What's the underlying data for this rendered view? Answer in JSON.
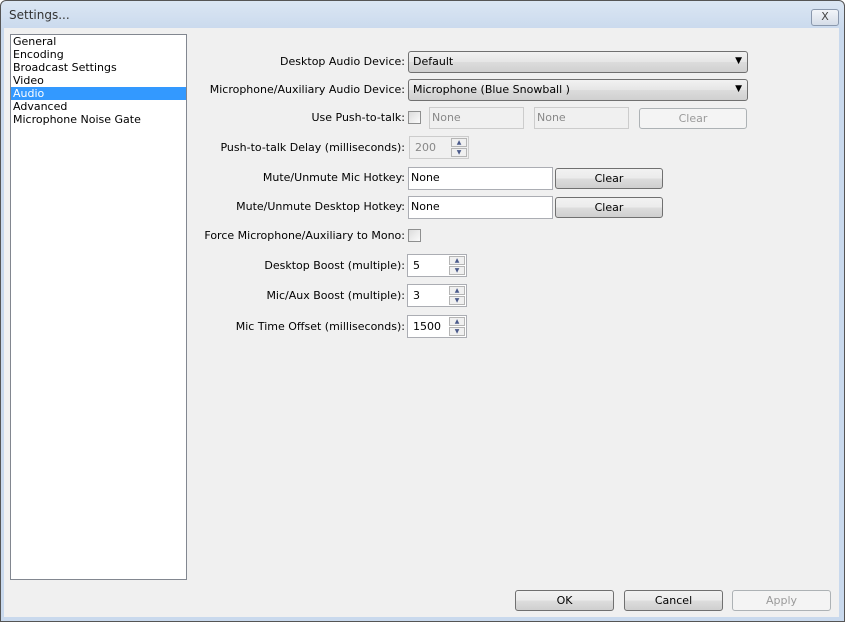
{
  "window": {
    "title": "Settings...",
    "close_label": "X"
  },
  "sidebar": {
    "items": [
      {
        "label": "General"
      },
      {
        "label": "Encoding"
      },
      {
        "label": "Broadcast Settings"
      },
      {
        "label": "Video"
      },
      {
        "label": "Audio",
        "selected": true
      },
      {
        "label": "Advanced"
      },
      {
        "label": "Microphone Noise Gate"
      }
    ]
  },
  "audio": {
    "desktop_device_label": "Desktop Audio Device:",
    "desktop_device_value": "Default",
    "mic_device_label": "Microphone/Auxiliary Audio Device:",
    "mic_device_value": "Microphone (Blue Snowball )",
    "ptt_label": "Use Push-to-talk:",
    "ptt_hotkey1": "None",
    "ptt_hotkey2": "None",
    "ptt_clear": "Clear",
    "ptt_delay_label": "Push-to-talk Delay (milliseconds):",
    "ptt_delay_value": "200",
    "mute_mic_label": "Mute/Unmute Mic Hotkey:",
    "mute_mic_value": "None",
    "mute_mic_clear": "Clear",
    "mute_desktop_label": "Mute/Unmute Desktop Hotkey:",
    "mute_desktop_value": "None",
    "mute_desktop_clear": "Clear",
    "mono_label": "Force Microphone/Auxiliary to Mono:",
    "desktop_boost_label": "Desktop Boost (multiple):",
    "desktop_boost_value": "5",
    "mic_boost_label": "Mic/Aux Boost (multiple):",
    "mic_boost_value": "3",
    "mic_offset_label": "Mic Time Offset (milliseconds):",
    "mic_offset_value": "1500"
  },
  "footer": {
    "ok": "OK",
    "cancel": "Cancel",
    "apply": "Apply"
  }
}
